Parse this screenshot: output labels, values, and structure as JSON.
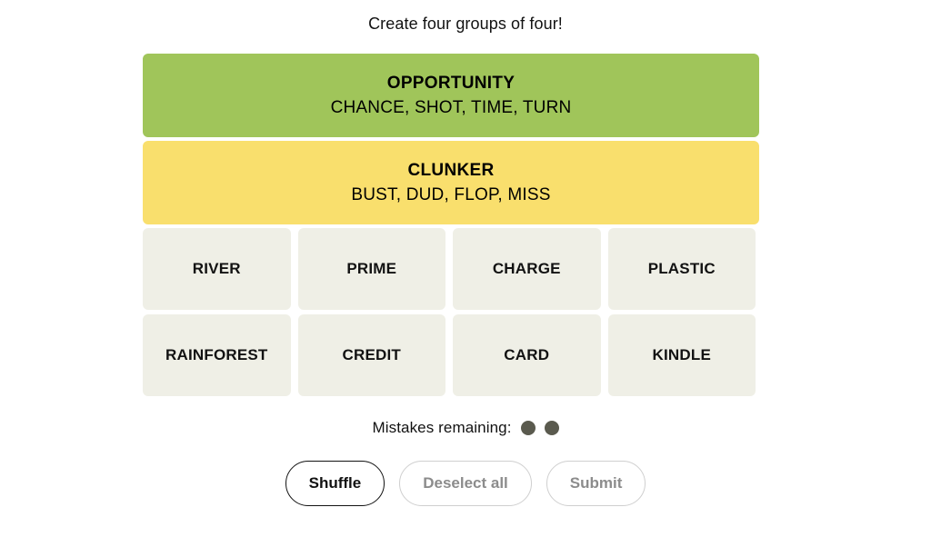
{
  "header": {
    "title": "Create four groups of four!"
  },
  "board": {
    "solved_groups": [
      {
        "name": "OPPORTUNITY",
        "members": "CHANCE, SHOT, TIME, TURN",
        "color": "#a0c55a"
      },
      {
        "name": "CLUNKER",
        "members": "BUST, DUD, FLOP, MISS",
        "color": "#f9df6d"
      }
    ],
    "tile_rows": [
      [
        "RIVER",
        "PRIME",
        "CHARGE",
        "PLASTIC"
      ],
      [
        "RAINFOREST",
        "CREDIT",
        "CARD",
        "KINDLE"
      ]
    ]
  },
  "mistakes": {
    "label": "Mistakes remaining:",
    "remaining": 2,
    "dot_color": "#5a5a4e"
  },
  "controls": {
    "shuffle_label": "Shuffle",
    "deselect_label": "Deselect all",
    "submit_label": "Submit"
  }
}
